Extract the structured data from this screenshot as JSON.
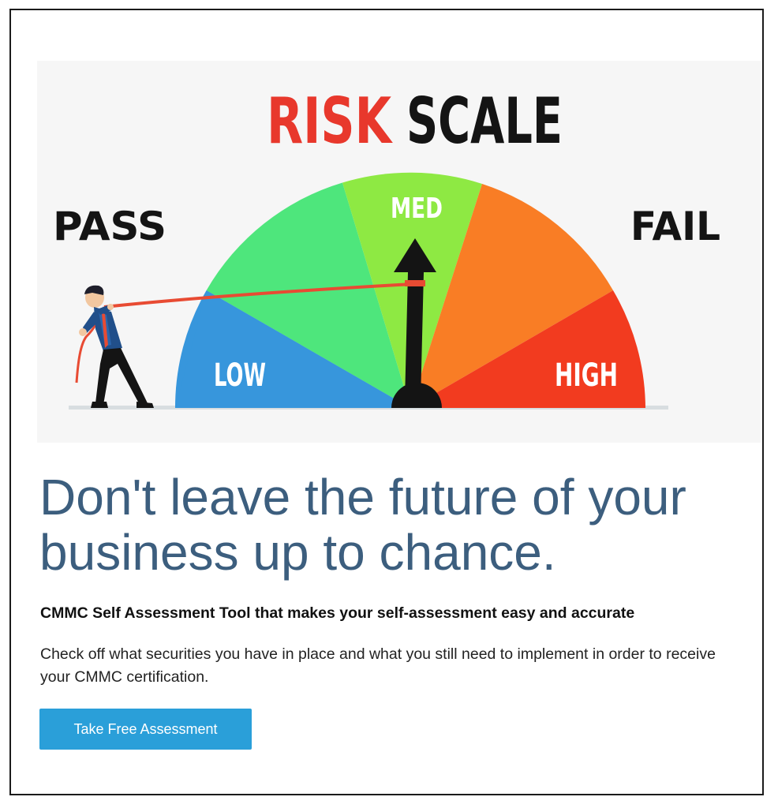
{
  "hero": {
    "title_word1": "RISK",
    "title_word2": "SCALE",
    "left_label": "PASS",
    "right_label": "FAIL",
    "gauge_labels": {
      "low": "LOW",
      "med": "MED",
      "high": "HIGH"
    },
    "colors": {
      "title_accent": "#e8382c",
      "low": "#3796dc",
      "low_green": "#4ee67c",
      "med": "#8ee943",
      "med_orange": "#f97d25",
      "high": "#f23b1f",
      "rope": "#e84b33",
      "needle": "#141414"
    }
  },
  "headline": "Don't leave the future of your business up to chance.",
  "subheading": "CMMC Self Assessment Tool that makes your self-assessment easy and accurate",
  "body": "Check off what securities you have in place and what you still need to implement in order to receive your  CMMC certification.",
  "cta": {
    "label": "Take Free Assessment",
    "color": "#2a9fd9"
  }
}
